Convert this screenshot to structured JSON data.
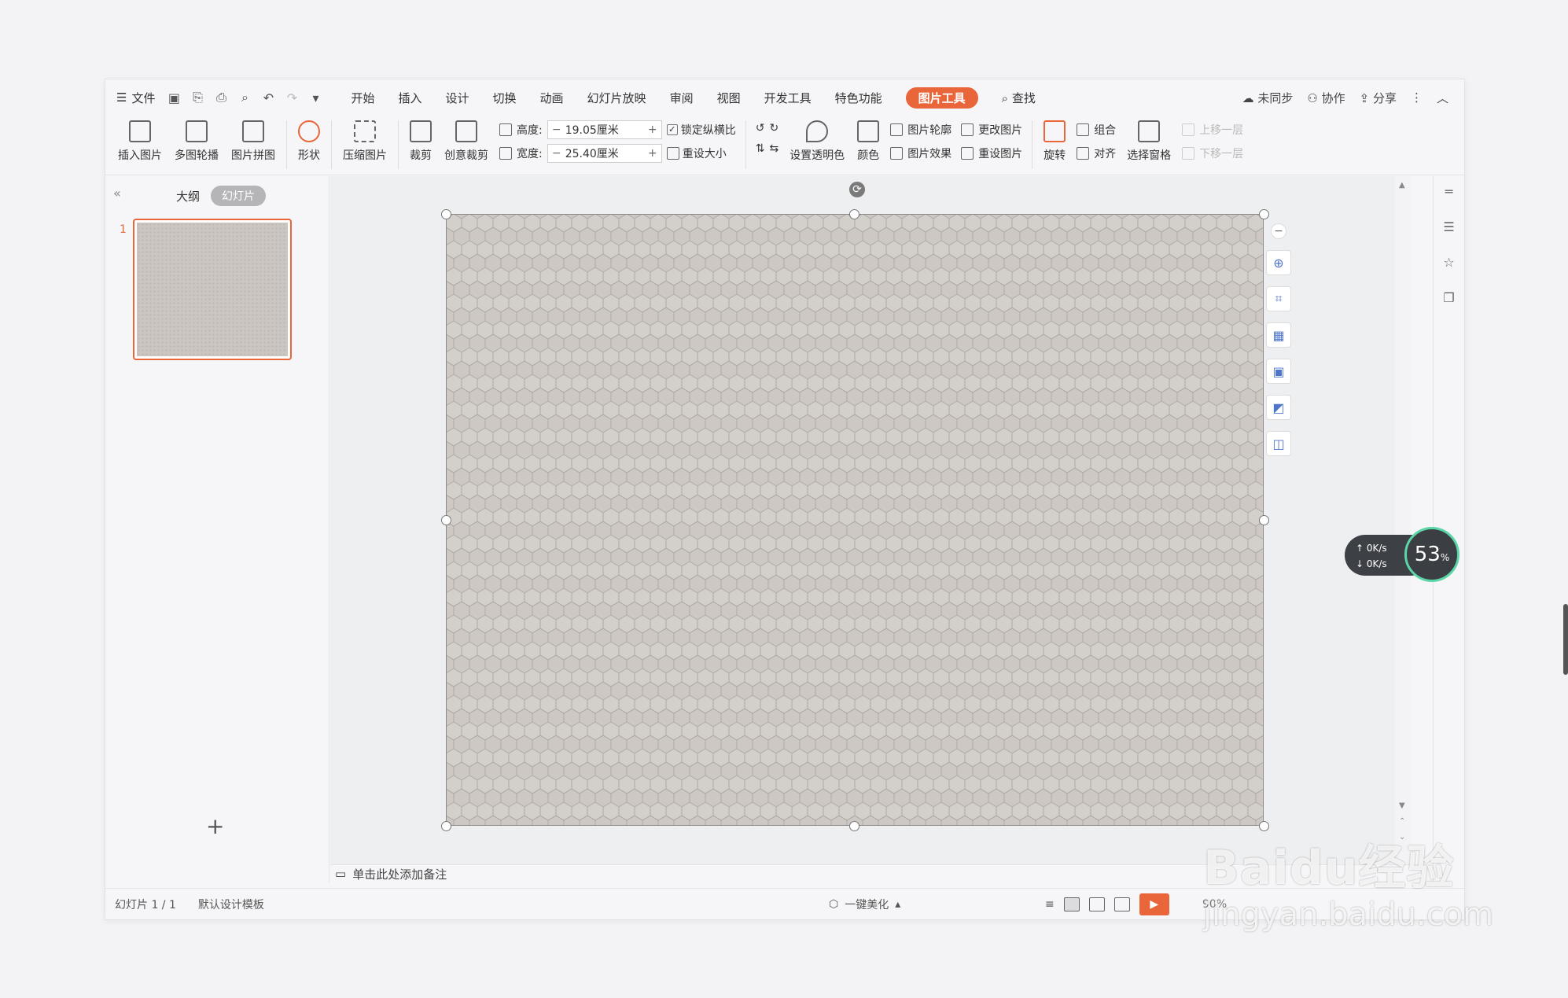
{
  "menu": {
    "file": "文件",
    "tabs": [
      "开始",
      "插入",
      "设计",
      "切换",
      "动画",
      "幻灯片放映",
      "审阅",
      "视图",
      "开发工具",
      "特色功能"
    ],
    "active_tab": "图片工具",
    "search": "查找",
    "right": {
      "sync": "未同步",
      "collab": "协作",
      "share": "分享"
    }
  },
  "ribbon": {
    "insert_picture": "插入图片",
    "multi_carousel": "多图轮播",
    "picture_collage": "图片拼图",
    "shape": "形状",
    "compress": "压缩图片",
    "crop": "裁剪",
    "creative_crop": "创意裁剪",
    "height_label": "高度:",
    "height_value": "19.05厘米",
    "width_label": "宽度:",
    "width_value": "25.40厘米",
    "lock_ratio": "锁定纵横比",
    "reset_size": "重设大小",
    "set_transparent": "设置透明色",
    "color": "颜色",
    "outline": "图片轮廓",
    "effects": "图片效果",
    "change_picture": "更改图片",
    "reset_picture": "重设图片",
    "rotate": "旋转",
    "group": "组合",
    "align": "对齐",
    "selection_pane": "选择窗格",
    "bring_forward": "上移一层",
    "send_backward": "下移一层"
  },
  "left_panel": {
    "outline_tab": "大纲",
    "slides_tab": "幻灯片",
    "slide_number": "1",
    "add": "+"
  },
  "notes_placeholder": "单击此处添加备注",
  "status": {
    "slide_counter": "幻灯片 1 / 1",
    "template": "默认设计模板",
    "beautify": "一键美化",
    "zoom": "90%"
  },
  "speed_widget": {
    "up": "0K/s",
    "down": "0K/s",
    "percent": "53",
    "unit": "%"
  },
  "watermark": {
    "logo": "Baidu经验",
    "sub": "jingyan.baidu.com"
  },
  "colors": {
    "accent": "#e8663a",
    "slide_texture": "#cdc8c4"
  }
}
